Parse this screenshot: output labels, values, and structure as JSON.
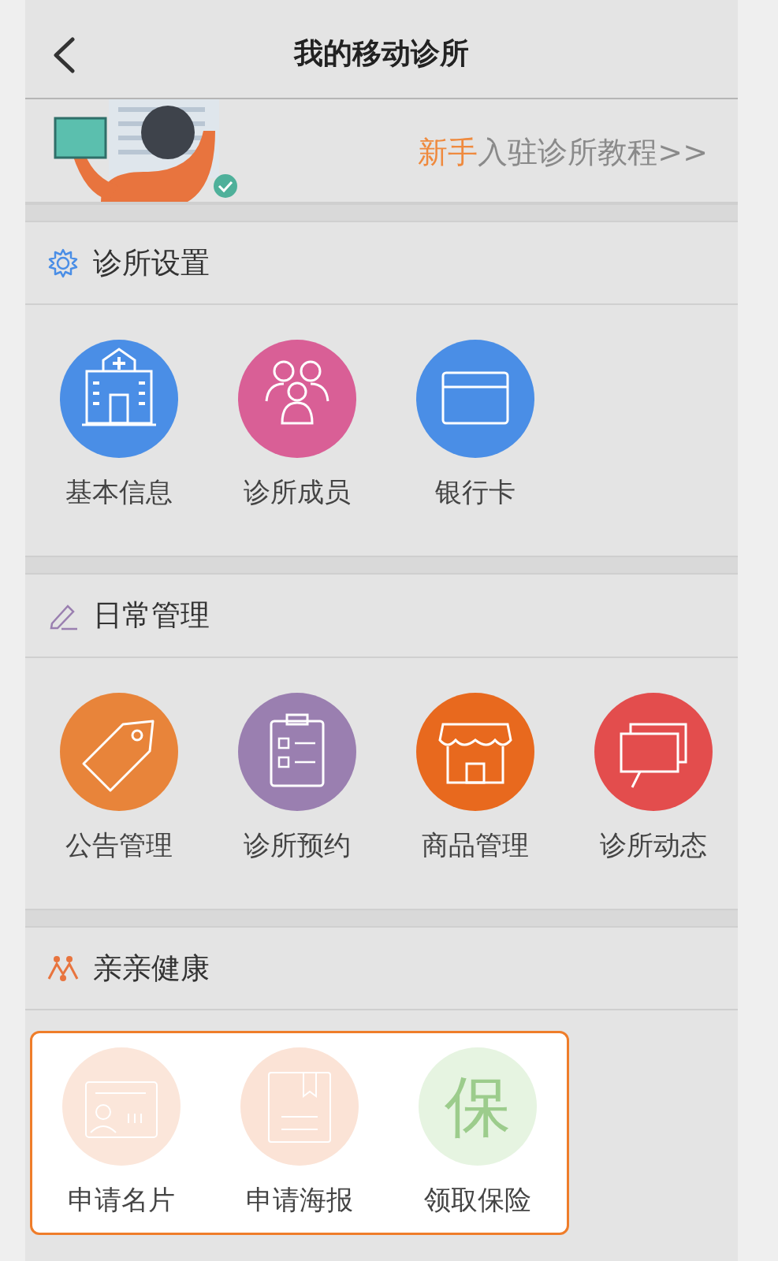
{
  "nav_bar": {
    "title": "我的移动诊所"
  },
  "banner": {
    "link_parts": [
      {
        "text": "新手",
        "accent": true
      },
      {
        "text": "入驻诊所教程>>",
        "accent": false
      }
    ]
  },
  "sections": [
    {
      "title": "诊所设置",
      "kind": "gear",
      "highlighted": false,
      "items": [
        {
          "label": "基本信息",
          "kind": "hospital",
          "color": "#4a8ee6"
        },
        {
          "label": "诊所成员",
          "kind": "people",
          "color": "#d95f96"
        },
        {
          "label": "银行卡",
          "kind": "card",
          "color": "#4a8ee6"
        }
      ]
    },
    {
      "title": "日常管理",
      "kind": "pen",
      "highlighted": false,
      "items": [
        {
          "label": "公告管理",
          "kind": "tag",
          "color": "#e8843a"
        },
        {
          "label": "诊所预约",
          "kind": "clipboard",
          "color": "#9a7fb0"
        },
        {
          "label": "商品管理",
          "kind": "shop",
          "color": "#e8691e"
        },
        {
          "label": "诊所动态",
          "kind": "chat",
          "color": "#e34d4d"
        }
      ]
    },
    {
      "title": "亲亲健康",
      "kind": "family",
      "highlighted": true,
      "items": [
        {
          "label": "申请名片",
          "kind": "idcard",
          "color": "#fbe6da"
        },
        {
          "label": "申请海报",
          "kind": "poster",
          "color": "#fbe3d6"
        },
        {
          "label": "领取保险",
          "kind": "glyph",
          "glyph": "保",
          "color": "#e6f4e1"
        }
      ]
    }
  ]
}
